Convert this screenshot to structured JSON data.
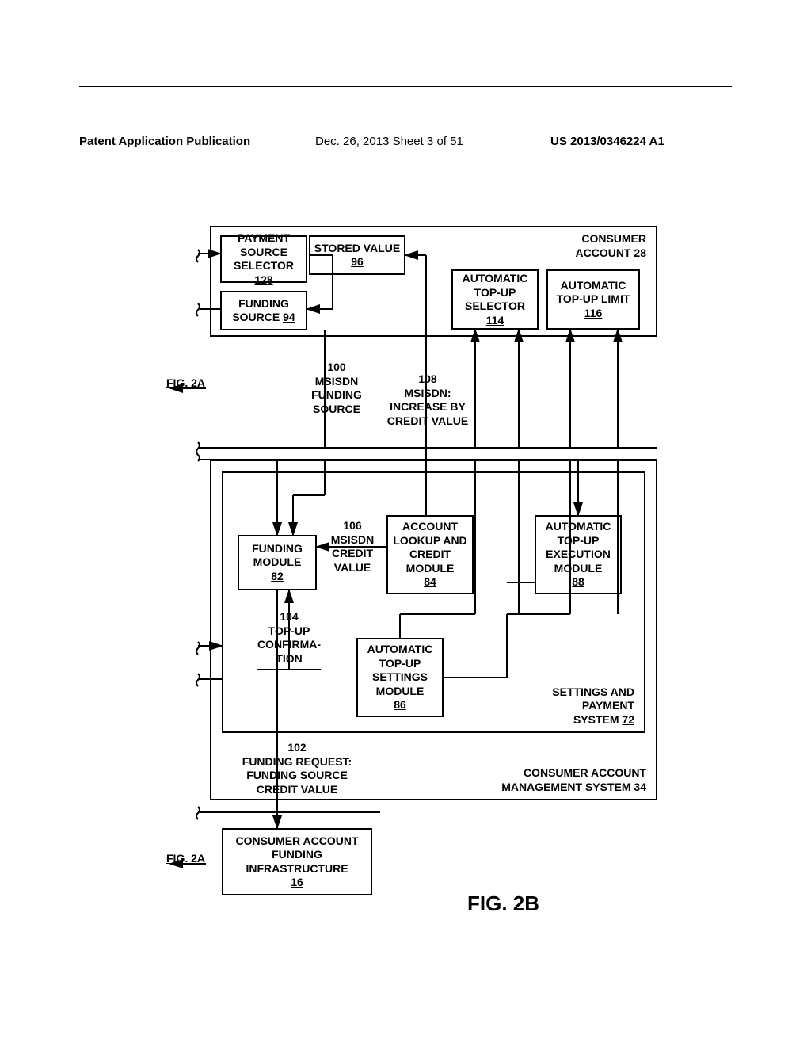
{
  "header": {
    "left": "Patent Application Publication",
    "mid": "Dec. 26, 2013  Sheet 3 of 51",
    "right": "US 2013/0346224 A1"
  },
  "figRefTop": "FIG. 2A",
  "figRefBottom": "FIG. 2A",
  "figCaption": "FIG. 2B",
  "boxes": {
    "consumerAccount": {
      "l1": "CONSUMER",
      "l2": "ACCOUNT",
      "ref": "28"
    },
    "paymentSourceSelector": {
      "l1": "PAYMENT",
      "l2": "SOURCE",
      "l3": "SELECTOR",
      "ref": "128"
    },
    "storedValue": {
      "l1": "STORED VALUE",
      "ref": "96"
    },
    "fundingSource": {
      "l1": "FUNDING",
      "l2": "SOURCE",
      "ref": "94"
    },
    "autoTopUpSelector": {
      "l1": "AUTOMATIC",
      "l2": "TOP-UP",
      "l3": "SELECTOR",
      "ref": "114"
    },
    "autoTopUpLimit": {
      "l1": "AUTOMATIC",
      "l2": "TOP-UP LIMIT",
      "ref": "116"
    },
    "fundingModule": {
      "l1": "FUNDING",
      "l2": "MODULE",
      "ref": "82"
    },
    "accountLookup": {
      "l1": "ACCOUNT",
      "l2": "LOOKUP AND",
      "l3": "CREDIT",
      "l4": "MODULE",
      "ref": "84"
    },
    "autoTopUpExec": {
      "l1": "AUTOMATIC",
      "l2": "TOP-UP",
      "l3": "EXECUTION",
      "l4": "MODULE",
      "ref": "88"
    },
    "autoTopUpSettings": {
      "l1": "AUTOMATIC",
      "l2": "TOP-UP",
      "l3": "SETTINGS",
      "l4": "MODULE",
      "ref": "86"
    },
    "consumerFundInfra": {
      "l1": "CONSUMER ACCOUNT",
      "l2": "FUNDING",
      "l3": "INFRASTRUCTURE",
      "ref": "16"
    }
  },
  "labels": {
    "msisdnFundingSource": {
      "num": "100",
      "l1": "MSISDN",
      "l2": "FUNDING",
      "l3": "SOURCE"
    },
    "msisdnIncrease": {
      "num": "108",
      "l1": "MSISDN:",
      "l2": "INCREASE BY",
      "l3": "CREDIT VALUE"
    },
    "msisdnCreditValue": {
      "num": "106",
      "l1": "MSISDN",
      "l2": "CREDIT",
      "l3": "VALUE"
    },
    "topUpConfirm": {
      "num": "104",
      "l1": "TOP-UP",
      "l2": "CONFIRMA-",
      "l3": "TION"
    },
    "fundingRequest": {
      "num": "102",
      "l1": "FUNDING REQUEST:",
      "l2": "FUNDING SOURCE",
      "l3": "CREDIT VALUE"
    },
    "settingsPayment": {
      "l1": "SETTINGS AND",
      "l2": "PAYMENT",
      "l3": "SYSTEM",
      "ref": "72"
    },
    "consumerAcctMgmt": {
      "l1": "CONSUMER ACCOUNT",
      "l2": "MANAGEMENT SYSTEM",
      "ref": "34"
    }
  }
}
